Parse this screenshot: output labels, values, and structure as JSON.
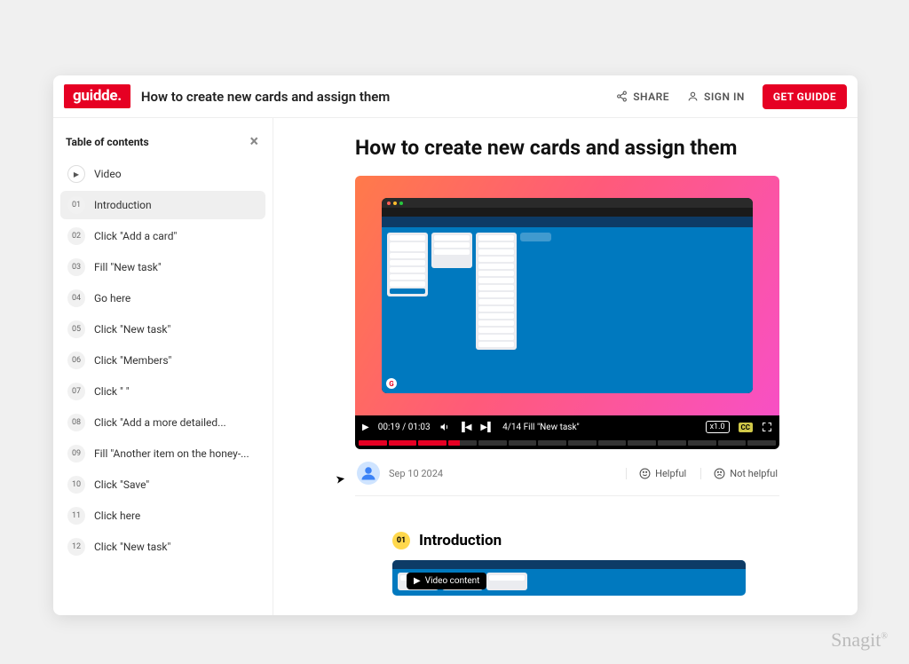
{
  "brand": "guidde.",
  "header": {
    "title": "How to create new cards and assign them",
    "share": "SHARE",
    "signin": "SIGN IN",
    "get": "GET GUIDDE"
  },
  "sidebar": {
    "heading": "Table of contents",
    "video_label": "Video",
    "items": [
      {
        "num": "01",
        "label": "Introduction",
        "active": true
      },
      {
        "num": "02",
        "label": "Click \"Add a card\""
      },
      {
        "num": "03",
        "label": "Fill \"New task\""
      },
      {
        "num": "04",
        "label": "Go here"
      },
      {
        "num": "05",
        "label": "Click \"New task\""
      },
      {
        "num": "06",
        "label": "Click \"Members\""
      },
      {
        "num": "07",
        "label": "Click \"                        \""
      },
      {
        "num": "08",
        "label": "Click \"Add a more detailed..."
      },
      {
        "num": "09",
        "label": "Fill \"Another item on the honey-..."
      },
      {
        "num": "10",
        "label": "Click \"Save\""
      },
      {
        "num": "11",
        "label": "Click here"
      },
      {
        "num": "12",
        "label": "Click \"New task\""
      }
    ]
  },
  "main": {
    "title": "How to create new cards and assign them"
  },
  "video": {
    "current_time": "00:19",
    "duration": "01:03",
    "chapter": "4/14 Fill \"New task\"",
    "speed": "x1.0",
    "cc": "CC",
    "segments_total": 14,
    "segments_done": 3
  },
  "meta": {
    "date": "Sep 10 2024",
    "helpful": "Helpful",
    "not_helpful": "Not helpful"
  },
  "section": {
    "num": "01",
    "title": "Introduction",
    "pill": "Video content"
  },
  "watermark": "Snagit"
}
